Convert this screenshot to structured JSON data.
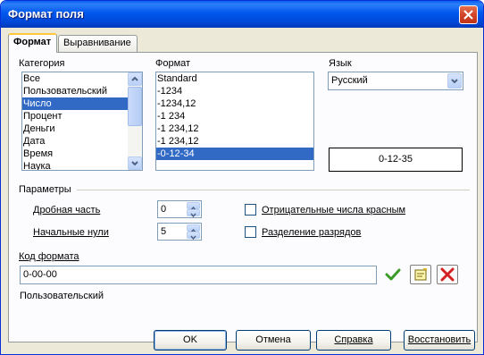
{
  "window": {
    "title": "Формат поля"
  },
  "tabs": [
    {
      "label": "Формат",
      "active": true
    },
    {
      "label": "Выравнивание",
      "active": false
    }
  ],
  "category": {
    "label": "Категория",
    "items": [
      "Все",
      "Пользовательский",
      "Число",
      "Процент",
      "Деньги",
      "Дата",
      "Время",
      "Наука"
    ],
    "selected_index": 2
  },
  "format": {
    "label": "Формат",
    "items": [
      "Standard",
      "-1234",
      "-1234,12",
      "-1 234",
      "-1 234,12",
      "-1 234,12",
      "-0-12-34"
    ],
    "selected_index": 6
  },
  "language": {
    "label": "Язык",
    "value": "Русский"
  },
  "preview": {
    "value": "0-12-35"
  },
  "options": {
    "heading": "Параметры",
    "decimal_label": "Дробная часть",
    "decimal_value": "0",
    "leading_zeros_label": "Начальные нули",
    "leading_zeros_value": "5",
    "negative_red_label": "Отрицательные числа красным",
    "negative_red_checked": false,
    "thousands_sep_label": "Разделение разрядов",
    "thousands_sep_checked": false
  },
  "format_code": {
    "label": "Код формата",
    "value": "0-00-00",
    "description": "Пользовательский"
  },
  "buttons": {
    "ok": "OK",
    "cancel": "Отмена",
    "help": "Справка",
    "reset": "Восстановить"
  },
  "colors": {
    "titlebar": "#0058ee",
    "selection": "#316ac5",
    "dialog_bg": "#ece9d8",
    "accept_icon": "#3c9a2a",
    "delete_icon": "#d42020"
  },
  "icons": {
    "close": "close-icon",
    "accept": "check-icon",
    "edit_comment": "edit-comment-icon",
    "delete": "delete-icon"
  }
}
